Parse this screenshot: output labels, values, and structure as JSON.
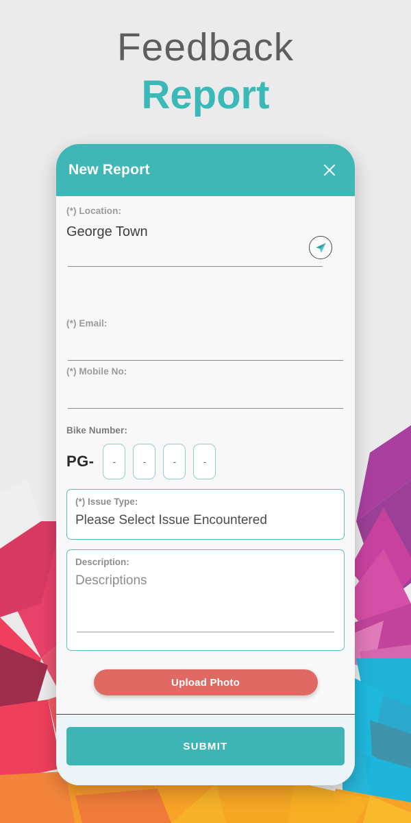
{
  "page": {
    "heading_line1": "Feedback",
    "heading_line2": "Report"
  },
  "colors": {
    "teal": "#3fb7b7",
    "heading_gray": "#5e5e5e",
    "coral": "#e06a63",
    "box_border": "#5dbbbb",
    "page_background": "#ebebeb"
  },
  "modal": {
    "title": "New Report",
    "close_icon": "close-icon",
    "fields": {
      "location": {
        "label": "(*) Location:",
        "value": "George Town",
        "action_icon": "send-icon"
      },
      "email": {
        "label": "(*) Email:",
        "value": "",
        "placeholder": ""
      },
      "mobile": {
        "label": "(*) Mobile No:",
        "value": "",
        "placeholder": ""
      },
      "bike_number": {
        "label": "Bike Number:",
        "prefix": "PG-",
        "boxes": [
          "-",
          "-",
          "-",
          "-"
        ]
      },
      "issue_type": {
        "label": "(*) Issue Type:",
        "value": "Please Select Issue Encountered"
      },
      "description": {
        "label": "Description:",
        "placeholder": "Descriptions"
      }
    },
    "upload_button": "Upload Photo",
    "submit_button": "SUBMIT"
  }
}
